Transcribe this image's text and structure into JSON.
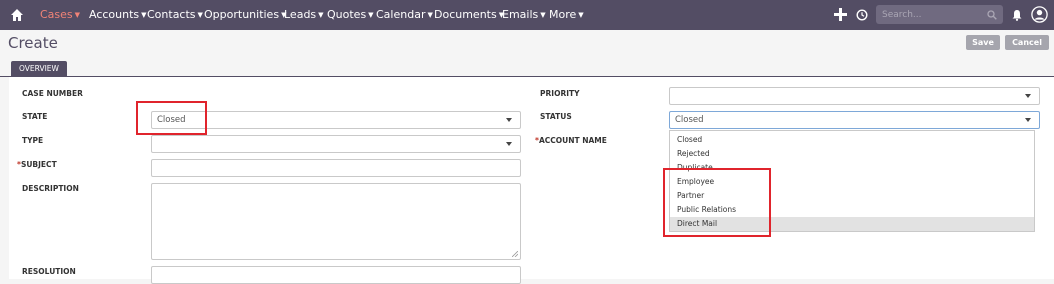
{
  "nav": {
    "items": [
      {
        "label": "Cases",
        "active": true
      },
      {
        "label": "Accounts"
      },
      {
        "label": "Contacts"
      },
      {
        "label": "Opportunities"
      },
      {
        "label": "Leads"
      },
      {
        "label": "Quotes"
      },
      {
        "label": "Calendar"
      },
      {
        "label": "Documents"
      },
      {
        "label": "Emails"
      },
      {
        "label": "More"
      }
    ],
    "search_placeholder": "Search...",
    "icons": [
      "home-icon",
      "plus-icon",
      "history-icon",
      "search-icon",
      "bell-icon",
      "user-icon"
    ]
  },
  "header": {
    "title": "Create",
    "save_label": "Save",
    "cancel_label": "Cancel"
  },
  "tab": {
    "label": "OVERVIEW"
  },
  "form": {
    "case_number_label": "CASE NUMBER",
    "state_label": "STATE",
    "state_value": "Closed",
    "type_label": "TYPE",
    "type_value": "",
    "subject_label": "SUBJECT",
    "subject_value": "",
    "description_label": "DESCRIPTION",
    "resolution_label": "RESOLUTION",
    "priority_label": "PRIORITY",
    "priority_value": "",
    "status_label": "STATUS",
    "status_value": "Closed",
    "account_name_label": "ACCOUNT NAME",
    "required_marker": "*"
  },
  "status_dropdown": {
    "options": [
      "Closed",
      "Rejected",
      "Duplicate",
      "Employee",
      "Partner",
      "Public Relations",
      "Direct Mail"
    ],
    "highlighted": "Direct Mail"
  },
  "colors": {
    "nav_bg": "#534d64",
    "nav_active": "#f08377",
    "button_bg": "#a5a5ad",
    "highlight_box": "#e0242c"
  }
}
